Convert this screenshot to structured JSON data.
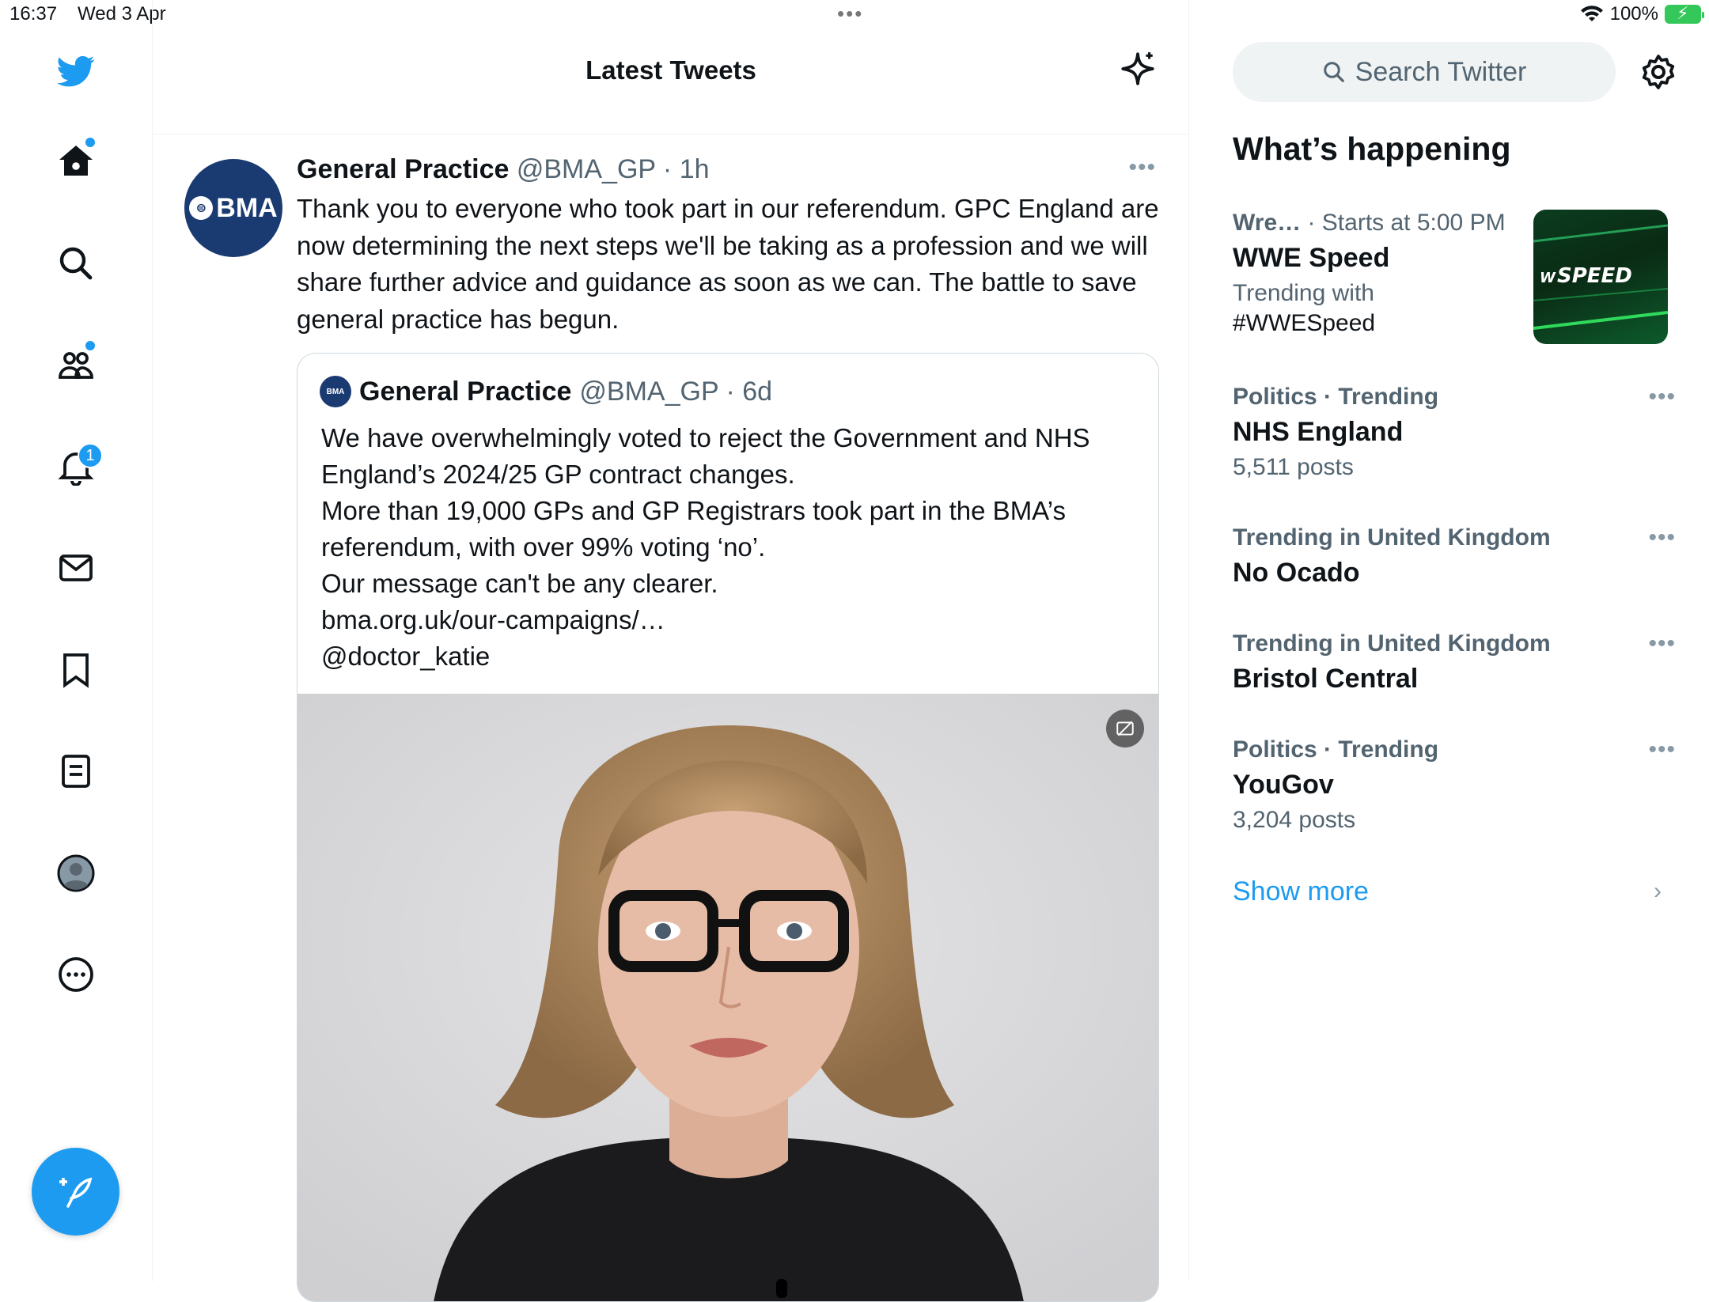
{
  "status_bar": {
    "time": "16:37",
    "date": "Wed 3 Apr",
    "battery": "100%"
  },
  "nav": {
    "notifications_badge": "1"
  },
  "main": {
    "title": "Latest Tweets",
    "tweet": {
      "name": "General Practice",
      "handle": "@BMA_GP",
      "separator": " · ",
      "time": "1h",
      "avatar_text": "BMA",
      "text": "Thank you to everyone who took part in our referendum. GPC England are now determining the next steps we'll be taking as a profession and we will share further advice and guidance as soon as we can. The battle to save general practice has begun.",
      "quote": {
        "avatar_text": "BMA",
        "name": "General Practice",
        "handle": "@BMA_GP",
        "separator": " · ",
        "time": "6d",
        "lines": [
          "We have overwhelmingly voted to reject the Government and NHS England’s 2024/25 GP contract changes.",
          "More than 19,000 GPs and GP Registrars took part in the BMA’s referendum, with over 99% voting ‘no’.",
          "Our message can't be any clearer.",
          "bma.org.uk/our-campaigns/…",
          "@doctor_katie"
        ]
      }
    }
  },
  "sidebar": {
    "search_placeholder": "Search Twitter",
    "whats_happening": "What’s happening",
    "trends": [
      {
        "meta_prefix": "Wre…",
        "meta": " · Starts at 5:00 PM",
        "title": "WWE Speed",
        "sub1": "Trending with",
        "sub2": "#WWESpeed"
      },
      {
        "meta": "Politics · Trending",
        "title": "NHS England",
        "sub1": "5,511 posts"
      },
      {
        "meta": "Trending in United Kingdom",
        "title": "No Ocado"
      },
      {
        "meta": "Trending in United Kingdom",
        "title": "Bristol Central"
      },
      {
        "meta": "Politics · Trending",
        "title": "YouGov",
        "sub1": "3,204 posts"
      }
    ],
    "show_more": "Show more",
    "wwe_image_text": "SPEED"
  },
  "colors": {
    "accent": "#1d9bf0",
    "bma_blue": "#1a3a72",
    "text_secondary": "#536471"
  }
}
